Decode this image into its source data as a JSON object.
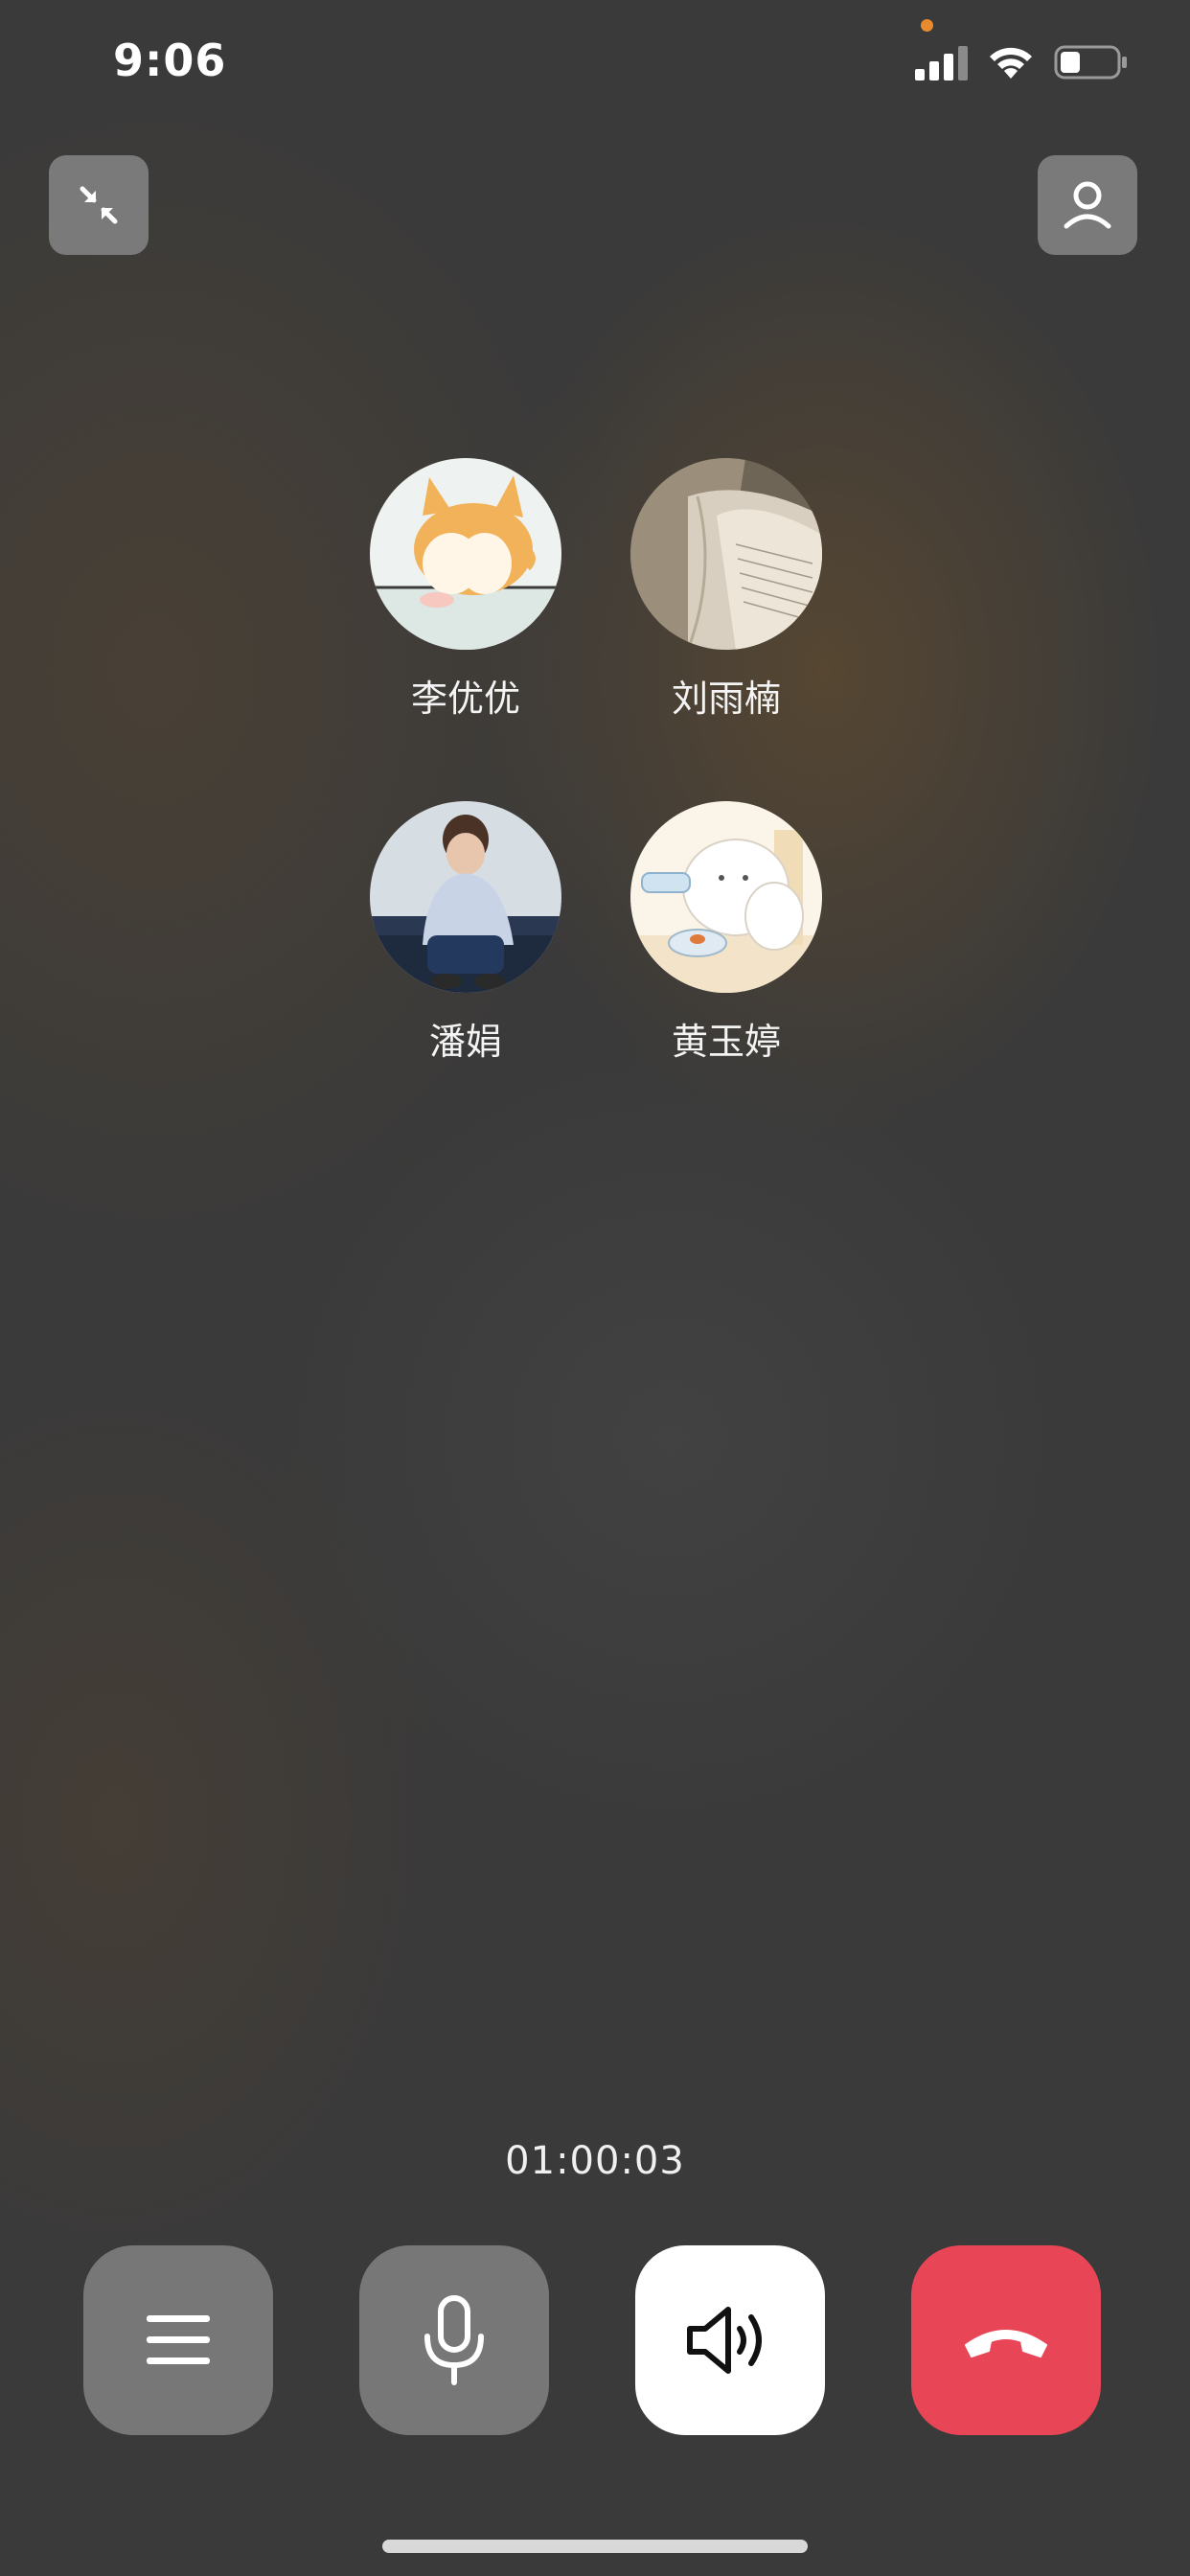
{
  "status_bar": {
    "time": "9:06",
    "icons": [
      "signal-icon",
      "wifi-icon",
      "battery-icon"
    ],
    "privacy_indicator_color": "#e88a2e",
    "battery_level": 0.3
  },
  "top_bar": {
    "left_button_icon": "minimize-icon",
    "right_button_icon": "person-icon"
  },
  "participants": [
    {
      "name": "李优优",
      "avatar_icon": "corgi-cartoon-avatar"
    },
    {
      "name": "刘雨楠",
      "avatar_icon": "open-book-photo-avatar"
    },
    {
      "name": "潘娟",
      "avatar_icon": "man-sitting-photo-avatar"
    },
    {
      "name": "黄玉婷",
      "avatar_icon": "cat-cartoon-avatar"
    }
  ],
  "call": {
    "duration": "01:00:03"
  },
  "controls": [
    {
      "id": "menu",
      "icon": "menu-icon",
      "color": "#777777"
    },
    {
      "id": "mic",
      "icon": "microphone-icon",
      "color": "#777777"
    },
    {
      "id": "speaker",
      "icon": "speaker-icon",
      "color": "#ffffff"
    },
    {
      "id": "hangup",
      "icon": "hang-up-icon",
      "color": "#e84657"
    }
  ]
}
